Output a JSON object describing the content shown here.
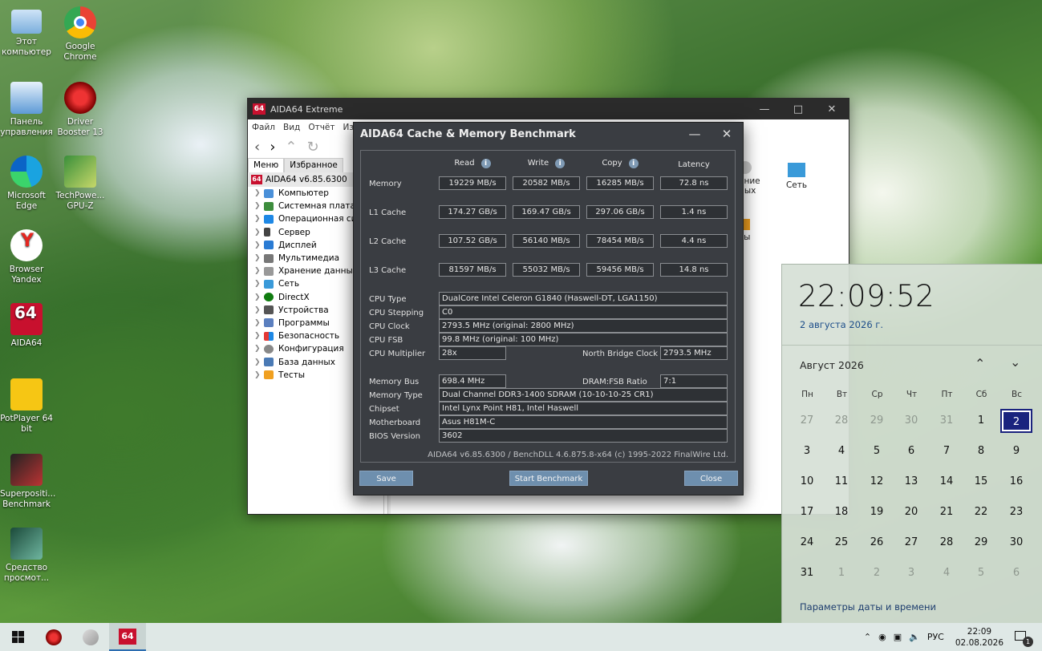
{
  "desktop": {
    "icons": [
      {
        "label": "Этот\nкомпьютер",
        "l1": "Этот",
        "l2": "компьютер"
      },
      {
        "l1": "Google",
        "l2": "Chrome"
      },
      {
        "l1": "Панель",
        "l2": "управления"
      },
      {
        "l1": "Driver",
        "l2": "Booster 13"
      },
      {
        "l1": "Microsoft",
        "l2": "Edge"
      },
      {
        "l1": "TechPowe...",
        "l2": "GPU-Z"
      },
      {
        "l1": "Browser",
        "l2": "Yandex"
      },
      {
        "l1": "AIDA64",
        "l2": ""
      },
      {
        "l1": "PotPlayer 64",
        "l2": "bit"
      },
      {
        "l1": "Superpositi...",
        "l2": "Benchmark"
      },
      {
        "l1": "Средство",
        "l2": "просмот..."
      }
    ]
  },
  "main_window": {
    "title": "AIDA64 Extreme",
    "logo": "64",
    "menu": [
      "Файл",
      "Вид",
      "Отчёт",
      "Изб"
    ],
    "tabs": {
      "menu": "Меню",
      "favorites": "Избранное"
    },
    "tree_root": "AIDA64 v6.85.6300",
    "tree_items": [
      "Компьютер",
      "Системная плата",
      "Операционная си",
      "Сервер",
      "Дисплей",
      "Мультимедиа",
      "Хранение данных",
      "Сеть",
      "DirectX",
      "Устройства",
      "Программы",
      "Безопасность",
      "Конфигурация",
      "База данных",
      "Тесты"
    ],
    "right_items": {
      "network": "Сеть",
      "frag1": "ение",
      "frag2": "ных",
      "frag3": "ты"
    }
  },
  "bench": {
    "title": "AIDA64 Cache & Memory Benchmark",
    "headers": {
      "read": "Read",
      "write": "Write",
      "copy": "Copy",
      "latency": "Latency"
    },
    "rows": [
      {
        "label": "Memory",
        "read": "19229 MB/s",
        "write": "20582 MB/s",
        "copy": "16285 MB/s",
        "latency": "72.8 ns"
      },
      {
        "label": "L1 Cache",
        "read": "174.27 GB/s",
        "write": "169.47 GB/s",
        "copy": "297.06 GB/s",
        "latency": "1.4 ns"
      },
      {
        "label": "L2 Cache",
        "read": "107.52 GB/s",
        "write": "56140 MB/s",
        "copy": "78454 MB/s",
        "latency": "4.4 ns"
      },
      {
        "label": "L3 Cache",
        "read": "81597 MB/s",
        "write": "55032 MB/s",
        "copy": "59456 MB/s",
        "latency": "14.8 ns"
      }
    ],
    "cpu": {
      "type_label": "CPU Type",
      "type": "DualCore Intel Celeron G1840  (Haswell-DT, LGA1150)",
      "stepping_label": "CPU Stepping",
      "stepping": "C0",
      "clock_label": "CPU Clock",
      "clock": "2793.5 MHz  (original: 2800 MHz)",
      "fsb_label": "CPU FSB",
      "fsb": "99.8 MHz  (original: 100 MHz)",
      "mult_label": "CPU Multiplier",
      "mult": "28x",
      "nb_label": "North Bridge Clock",
      "nb": "2793.5 MHz"
    },
    "mem": {
      "bus_label": "Memory Bus",
      "bus": "698.4 MHz",
      "ratio_label": "DRAM:FSB Ratio",
      "ratio": "7:1",
      "type_label": "Memory Type",
      "type": "Dual Channel DDR3-1400 SDRAM  (10-10-10-25 CR1)",
      "chipset_label": "Chipset",
      "chipset": "Intel Lynx Point H81, Intel Haswell",
      "mobo_label": "Motherboard",
      "mobo": "Asus H81M-C",
      "bios_label": "BIOS Version",
      "bios": "3602"
    },
    "footer": "AIDA64 v6.85.6300 / BenchDLL 4.6.875.8-x64  (c) 1995-2022 FinalWire Ltd.",
    "buttons": {
      "save": "Save",
      "start": "Start Benchmark",
      "close": "Close"
    }
  },
  "calendar": {
    "time": "22:09:52",
    "date": "2 августа 2026 г.",
    "month": "Август 2026",
    "dow": [
      "Пн",
      "Вт",
      "Ср",
      "Чт",
      "Пт",
      "Сб",
      "Вс"
    ],
    "weeks": [
      [
        "27",
        "28",
        "29",
        "30",
        "31",
        "1",
        "2"
      ],
      [
        "3",
        "4",
        "5",
        "6",
        "7",
        "8",
        "9"
      ],
      [
        "10",
        "11",
        "12",
        "13",
        "14",
        "15",
        "16"
      ],
      [
        "17",
        "18",
        "19",
        "20",
        "21",
        "22",
        "23"
      ],
      [
        "24",
        "25",
        "26",
        "27",
        "28",
        "29",
        "30"
      ],
      [
        "31",
        "1",
        "2",
        "3",
        "4",
        "5",
        "6"
      ]
    ],
    "link": "Параметры даты и времени"
  },
  "taskbar": {
    "lang": "РУС",
    "time": "22:09",
    "date": "02.08.2026",
    "aida_logo": "64",
    "notif_count": "1"
  }
}
